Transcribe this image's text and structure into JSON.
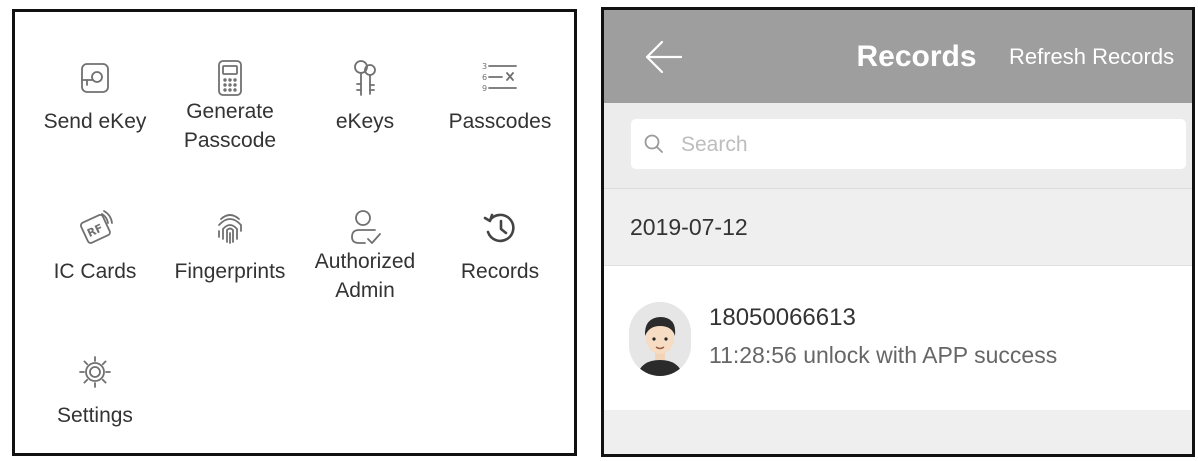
{
  "menu": {
    "items": [
      {
        "label": "Send eKey",
        "icon": "send-ekey-icon"
      },
      {
        "label": "Generate\nPasscode",
        "icon": "keypad-icon"
      },
      {
        "label": "eKeys",
        "icon": "keys-icon"
      },
      {
        "label": "Passcodes",
        "icon": "passcode-list-icon"
      },
      {
        "label": "IC Cards",
        "icon": "rf-card-icon"
      },
      {
        "label": "Fingerprints",
        "icon": "fingerprint-icon"
      },
      {
        "label": "Authorized\nAdmin",
        "icon": "admin-user-icon"
      },
      {
        "label": "Records",
        "icon": "history-icon"
      },
      {
        "label": "Settings",
        "icon": "gear-icon"
      }
    ]
  },
  "records_screen": {
    "title": "Records",
    "refresh_label": "Refresh Records",
    "search": {
      "placeholder": "Search",
      "value": ""
    },
    "date_header": "2019-07-12",
    "records": [
      {
        "name": "18050066613",
        "detail": "11:28:56 unlock with APP success"
      }
    ]
  },
  "colors": {
    "header_bg": "#9e9e9e",
    "section_bg": "#efefef",
    "text": "#333333",
    "icon_stroke": "#707070"
  }
}
